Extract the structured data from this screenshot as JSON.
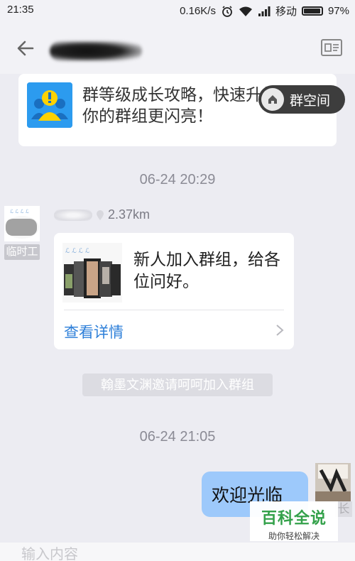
{
  "status": {
    "time": "21:35",
    "network_speed": "0.16K/s",
    "carrier": "移动",
    "battery": "97%",
    "icons": [
      "alarm-icon",
      "wifi-icon",
      "signal-icon",
      "battery-icon"
    ]
  },
  "nav": {
    "back_icon": "arrow-left-icon",
    "profile_icon": "profile-card-icon"
  },
  "promo": {
    "text": "群等级成长攻略，快速升级让你的群组更闪亮！",
    "icon": "group-alert-icon"
  },
  "group_space": {
    "label": "群空间",
    "icon": "home-icon"
  },
  "messages": {
    "timestamp_1": "06-24 20:29",
    "sender_distance": "2.37km",
    "sender_role": "临时工",
    "share_text": "新人加入群组，给各位问好。",
    "share_link": "查看详情",
    "system_notice": "翰墨文渊邀请呵呵加入群组",
    "timestamp_2": "06-24 21:05",
    "my_message": "欢迎光临",
    "my_role": "长"
  },
  "watermark": {
    "title": "百科全说",
    "subtitle": "助你轻松解决"
  },
  "input": {
    "placeholder": "输入内容"
  },
  "colors": {
    "accent_blue": "#2f80d9",
    "my_bubble": "#9dc9fb",
    "background": "#ececf2",
    "watermark_green": "#33a14a"
  }
}
